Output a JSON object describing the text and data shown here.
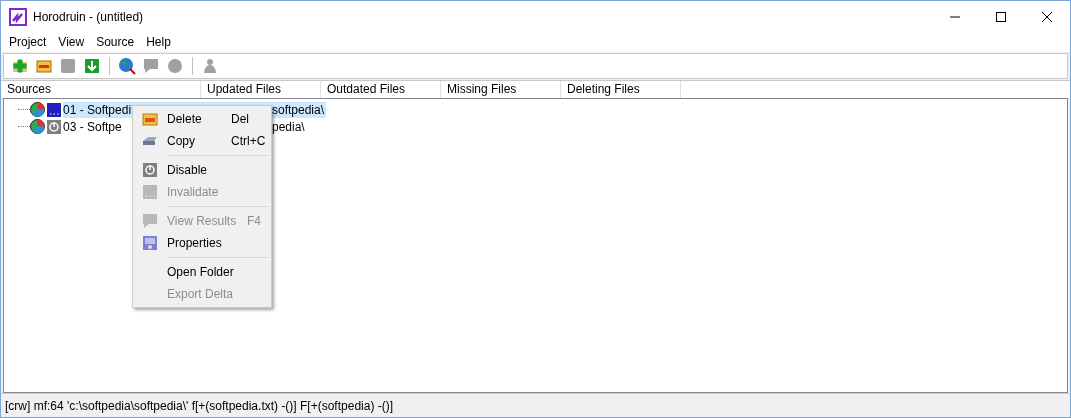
{
  "window": {
    "title": "Horodruin - (untitled)"
  },
  "menu_bar": [
    "Project",
    "View",
    "Source",
    "Help"
  ],
  "toolbar": [
    {
      "kind": "add",
      "disabled": false
    },
    {
      "kind": "remove",
      "disabled": false
    },
    {
      "kind": "stop",
      "disabled": true
    },
    {
      "kind": "download",
      "disabled": false
    },
    {
      "kind": "sep"
    },
    {
      "kind": "globe",
      "disabled": false
    },
    {
      "kind": "comment",
      "disabled": true
    },
    {
      "kind": "circle",
      "disabled": true
    },
    {
      "kind": "sep"
    },
    {
      "kind": "person",
      "disabled": true
    }
  ],
  "table": {
    "columns": [
      "Sources",
      "Updated Files",
      "Outdated Files",
      "Missing Files",
      "Deleting Files"
    ],
    "rows": [
      {
        "name": "01 -  Softpedi",
        "path_tail": "softpedia\\",
        "selected": true
      },
      {
        "name": "03 -  Softpe",
        "path_tail": "pedia\\",
        "selected": false
      }
    ]
  },
  "context_menu": [
    {
      "kind": "item",
      "label": "Delete",
      "shortcut": "Del",
      "disabled": false
    },
    {
      "kind": "item",
      "label": "Copy",
      "shortcut": "Ctrl+C",
      "disabled": false
    },
    {
      "kind": "sep"
    },
    {
      "kind": "item",
      "label": "Disable",
      "disabled": false
    },
    {
      "kind": "item",
      "label": "Invalidate",
      "disabled": true
    },
    {
      "kind": "sep"
    },
    {
      "kind": "item",
      "label": "View Results",
      "shortcut": "F4",
      "disabled": true
    },
    {
      "kind": "item",
      "label": "Properties",
      "disabled": false
    },
    {
      "kind": "sep"
    },
    {
      "kind": "item",
      "label": "Open Folder",
      "disabled": false
    },
    {
      "kind": "item",
      "label": "Export Delta",
      "disabled": true
    }
  ],
  "status_bar": "[crw] mf:64 'c:\\softpedia\\softpedia\\' f[+(softpedia.txt) -()] F[+(softpedia) -()]"
}
